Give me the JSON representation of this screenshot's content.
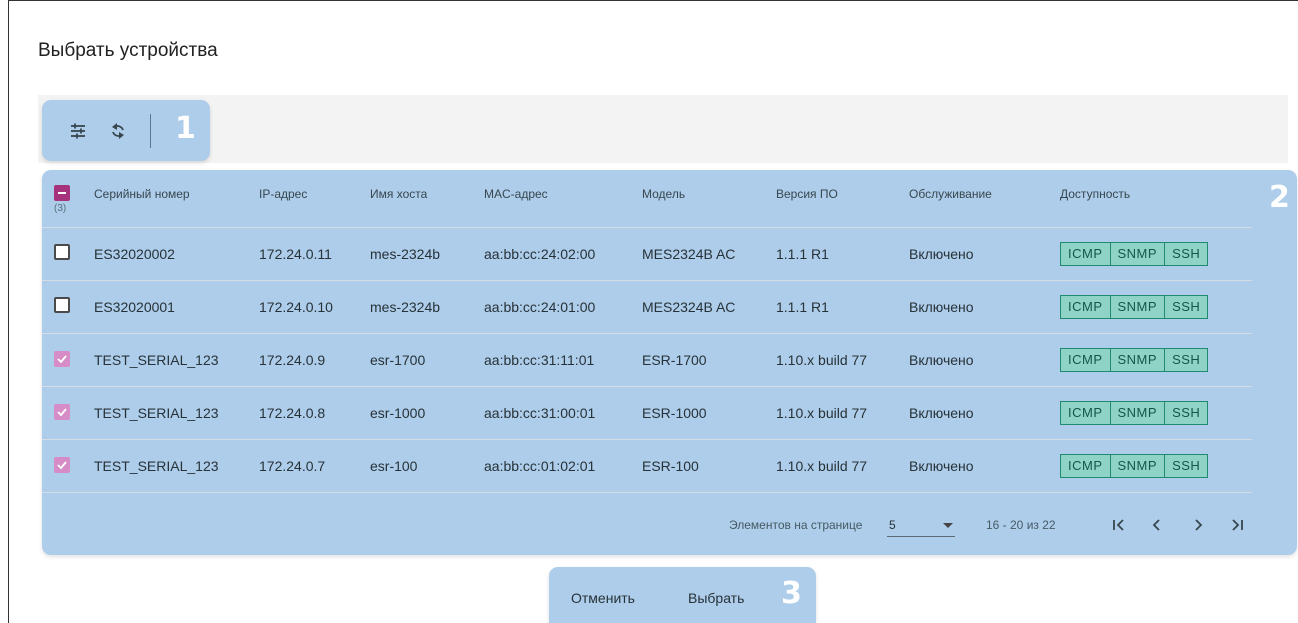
{
  "dialog": {
    "title": "Выбрать устройства"
  },
  "toolbar": {
    "icons": [
      "tune-icon",
      "refresh-icon"
    ],
    "callout_number": "1"
  },
  "table": {
    "callout_number": "2",
    "selected_count": "(3)",
    "columns": [
      "Серийный номер",
      "IP-адрес",
      "Имя хоста",
      "MAC-адрес",
      "Модель",
      "Версия ПО",
      "Обслуживание",
      "Доступность"
    ],
    "rows": [
      {
        "checked": false,
        "serial": "ES32020002",
        "ip": "172.24.0.11",
        "host": "mes-2324b",
        "mac": "aa:bb:cc:24:02:00",
        "model": "MES2324B AC",
        "firmware": "1.1.1 R1",
        "service": "Включено",
        "availability": [
          "ICMP",
          "SNMP",
          "SSH"
        ]
      },
      {
        "checked": false,
        "serial": "ES32020001",
        "ip": "172.24.0.10",
        "host": "mes-2324b",
        "mac": "aa:bb:cc:24:01:00",
        "model": "MES2324B AC",
        "firmware": "1.1.1 R1",
        "service": "Включено",
        "availability": [
          "ICMP",
          "SNMP",
          "SSH"
        ]
      },
      {
        "checked": true,
        "serial": "TEST_SERIAL_123",
        "ip": "172.24.0.9",
        "host": "esr-1700",
        "mac": "aa:bb:cc:31:11:01",
        "model": "ESR-1700",
        "firmware": "1.10.x build 77",
        "service": "Включено",
        "availability": [
          "ICMP",
          "SNMP",
          "SSH"
        ]
      },
      {
        "checked": true,
        "serial": "TEST_SERIAL_123",
        "ip": "172.24.0.8",
        "host": "esr-1000",
        "mac": "aa:bb:cc:31:00:01",
        "model": "ESR-1000",
        "firmware": "1.10.x build 77",
        "service": "Включено",
        "availability": [
          "ICMP",
          "SNMP",
          "SSH"
        ]
      },
      {
        "checked": true,
        "serial": "TEST_SERIAL_123",
        "ip": "172.24.0.7",
        "host": "esr-100",
        "mac": "aa:bb:cc:01:02:01",
        "model": "ESR-100",
        "firmware": "1.10.x build 77",
        "service": "Включено",
        "availability": [
          "ICMP",
          "SNMP",
          "SSH"
        ]
      }
    ]
  },
  "paginator": {
    "items_per_page_label": "Элементов на странице",
    "page_size": "5",
    "range_label": "16 - 20 из 22"
  },
  "actions": {
    "cancel_label": "Отменить",
    "select_label": "Выбрать",
    "callout_number": "3"
  },
  "colors": {
    "callout_bg": "#aecdea",
    "checkbox_checked": "#d58cc7",
    "checkbox_indeterminate": "#a6337c",
    "availability_chip": "#8fd3c6"
  }
}
